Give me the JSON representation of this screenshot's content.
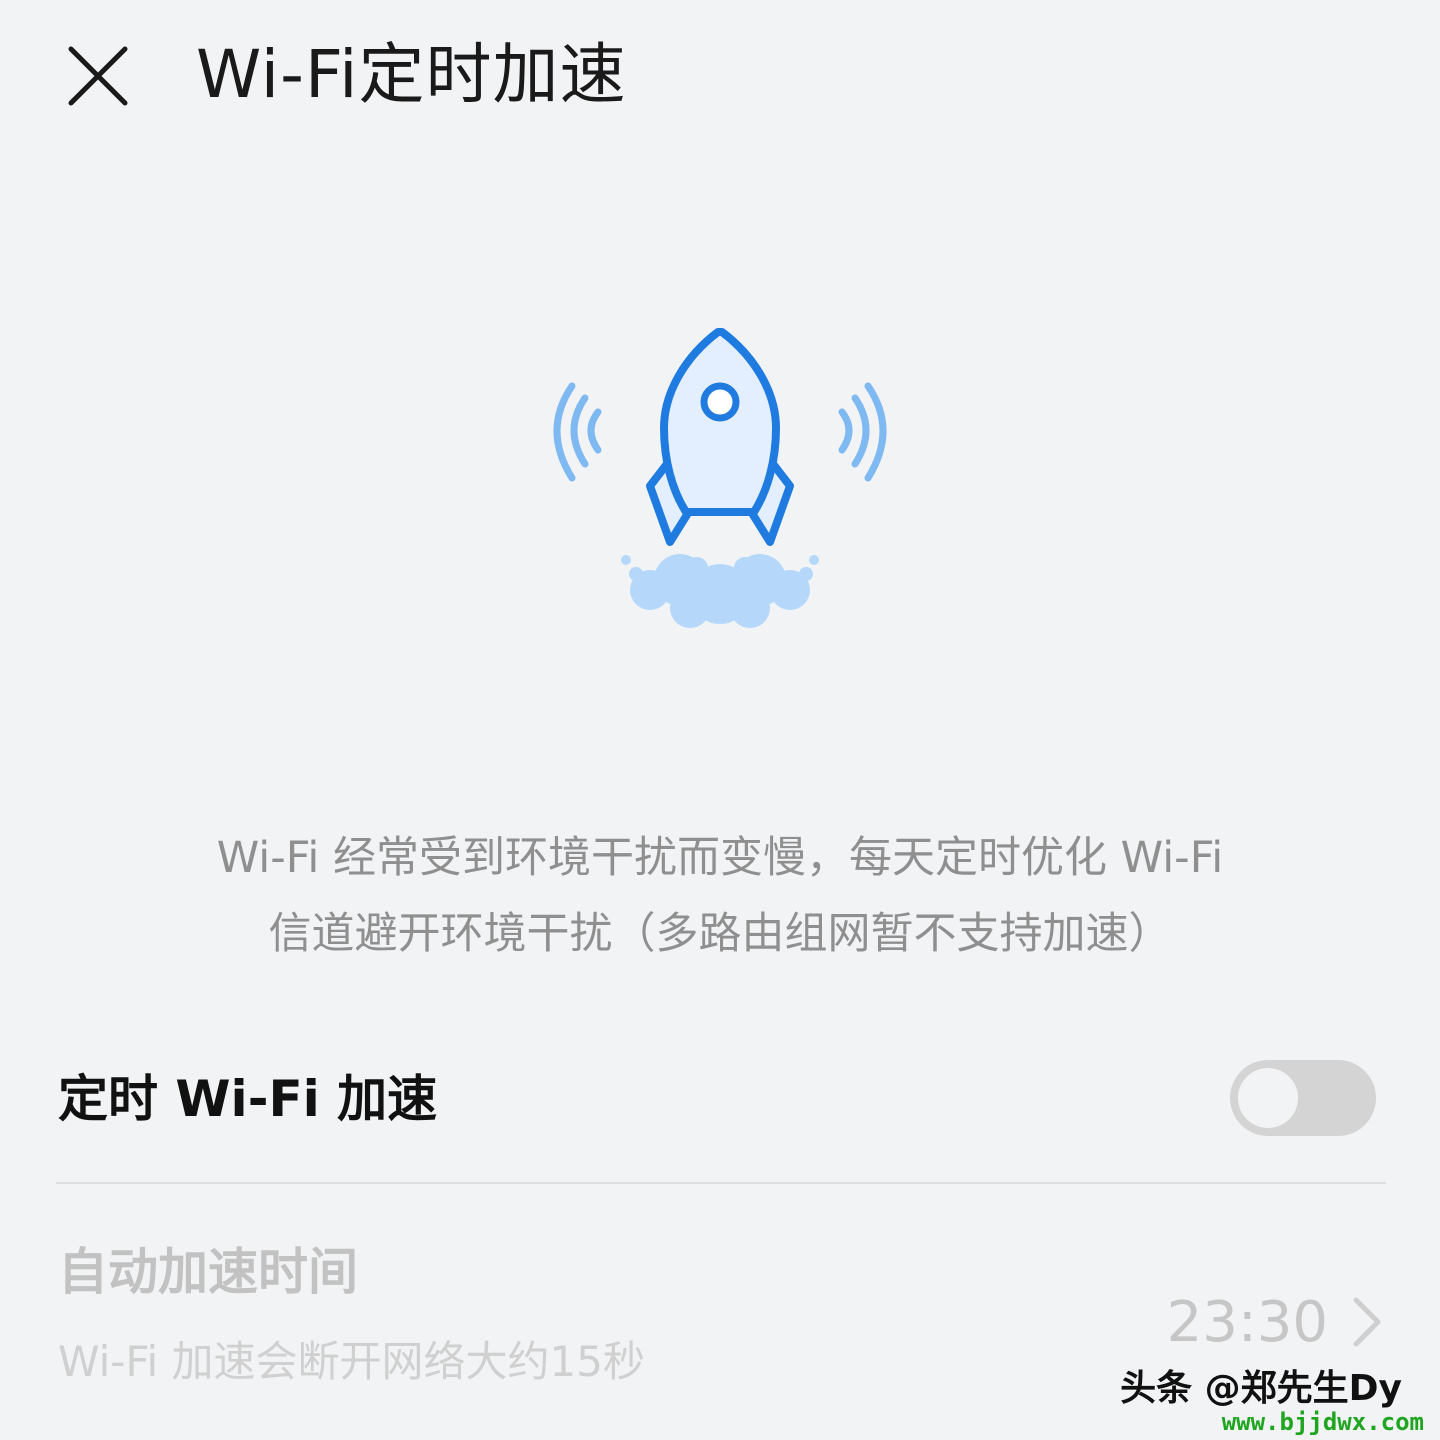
{
  "header": {
    "title": "Wi-Fi定时加速",
    "close_icon": "close-icon"
  },
  "illustration": {
    "icon": "rocket-icon",
    "accent_color": "#1f7be0",
    "fill_color": "#e3efff",
    "signal_color": "#7fb9f2",
    "cloud_color": "#b5d8fa"
  },
  "description": {
    "line1": "Wi-Fi 经常受到环境干扰而变慢，每天定时优化 Wi-Fi",
    "line2": "信道避开环境干扰（多路由组网暂不支持加速）"
  },
  "schedule_toggle": {
    "label": "定时 Wi-Fi 加速",
    "state": "off"
  },
  "auto_time": {
    "label": "自动加速时间",
    "subtitle": "Wi-Fi 加速会断开网络大约15秒",
    "value": "23:30",
    "chevron_icon": "chevron-right-icon"
  },
  "watermark": {
    "text": "头条 @郑先生Dy",
    "url": "www.bjjdwx.com"
  }
}
